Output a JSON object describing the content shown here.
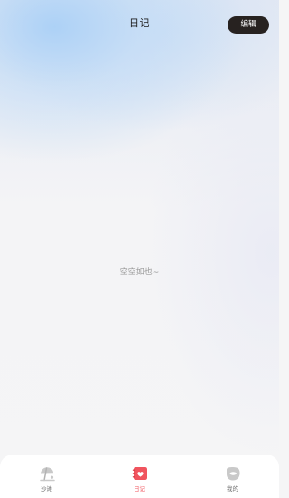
{
  "header": {
    "title": "日记",
    "edit_label": "编辑"
  },
  "main": {
    "empty_text": "空空如也~"
  },
  "tabbar": {
    "active_color": "#f0545e",
    "inactive_color": "#6e6e6e",
    "items": [
      {
        "label": "沙滩",
        "icon": "beach-umbrella-icon",
        "active": false
      },
      {
        "label": "日记",
        "icon": "diary-heart-icon",
        "active": true
      },
      {
        "label": "我的",
        "icon": "profile-blob-icon",
        "active": false
      }
    ]
  }
}
